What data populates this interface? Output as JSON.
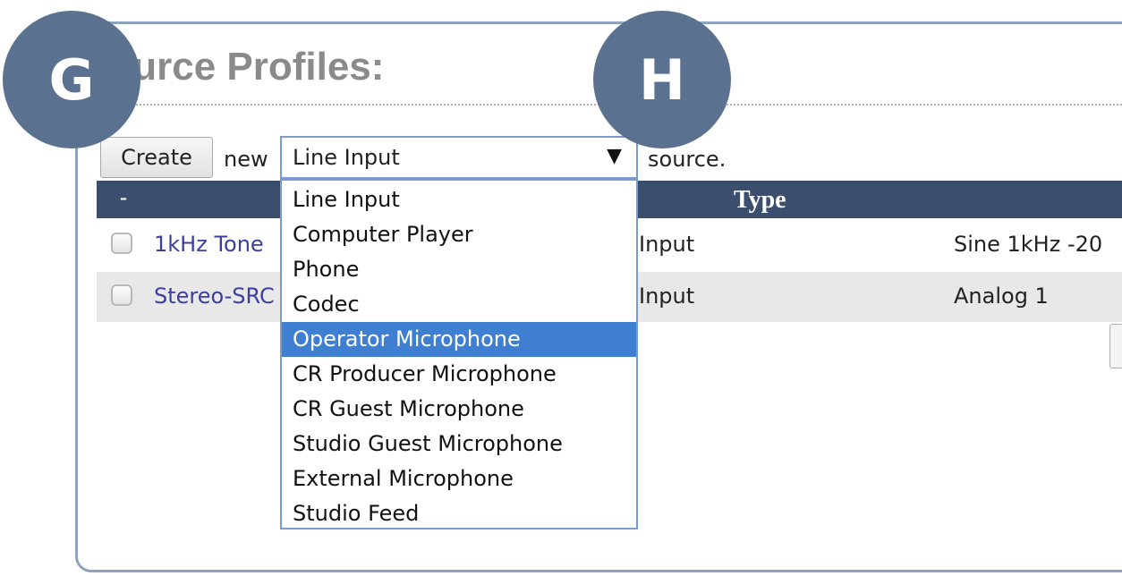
{
  "callouts": {
    "g": "G",
    "h": "H"
  },
  "page": {
    "title": "Source Profiles:"
  },
  "create_bar": {
    "create_button": "Create",
    "new_text": "new",
    "select_value": "Line Input",
    "select_arrow": "▼",
    "source_text": "source."
  },
  "table": {
    "headers": {
      "dash": "-",
      "type": "Type"
    },
    "rows": [
      {
        "name": "1kHz Tone",
        "type": "Input",
        "detail": "Sine 1kHz -20"
      },
      {
        "name": "Stereo-SRC",
        "type": "Input",
        "detail": "Analog 1"
      }
    ]
  },
  "dropdown": {
    "selected_index": 4,
    "options": [
      "Line Input",
      "Computer Player",
      "Phone",
      "Codec",
      "Operator Microphone",
      "CR Producer Microphone",
      "CR Guest Microphone",
      "Studio Guest Microphone",
      "External Microphone",
      "Studio Feed"
    ]
  },
  "colors": {
    "callout_fill": "#5b7190",
    "table_header": "#3c4e6d",
    "selected_option": "#3f7fd2",
    "link_text": "#3a3fa0"
  },
  "icons": {
    "select_arrow": "chevron-down-icon",
    "row_checkbox": "checkbox-icon"
  }
}
